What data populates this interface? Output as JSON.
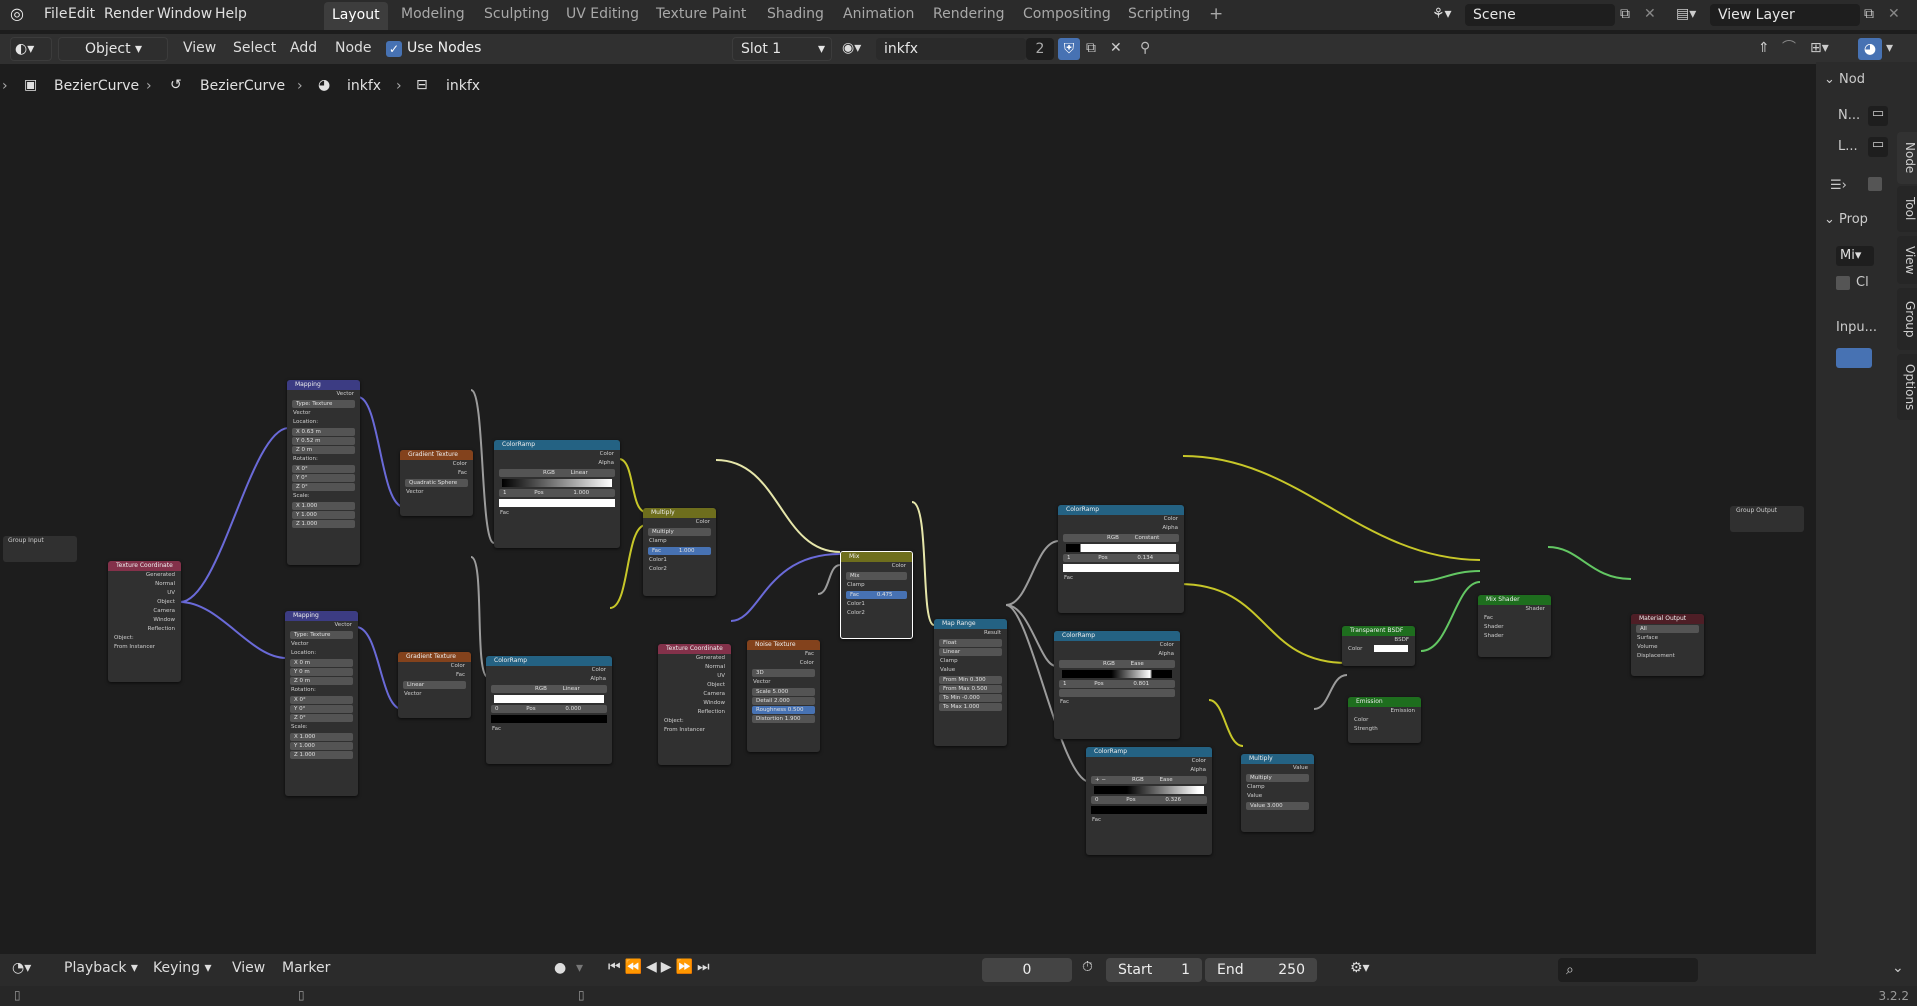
{
  "topbar": {
    "menus": [
      "File",
      "Edit",
      "Render",
      "Window",
      "Help"
    ],
    "workspaces": [
      "Layout",
      "Modeling",
      "Sculpting",
      "UV Editing",
      "Texture Paint",
      "Shading",
      "Animation",
      "Rendering",
      "Compositing",
      "Scripting"
    ],
    "active_workspace": "Layout",
    "add_tab": "+",
    "scene": "Scene",
    "view_layer": "View Layer"
  },
  "header": {
    "object_mode": "Object",
    "menus": [
      "View",
      "Select",
      "Add",
      "Node"
    ],
    "use_nodes": "Use Nodes",
    "slot": "Slot 1",
    "material": "inkfx",
    "users": "2"
  },
  "breadcrumb": [
    "BezierCurve",
    "BezierCurve",
    "inkfx",
    "inkfx"
  ],
  "npanel": {
    "node_title": "Nod",
    "name_label": "N...",
    "label_label": "L...",
    "props_title": "Prop",
    "mix_value": "Mi",
    "clamp_label": "Cl",
    "input_label": "Inpu...",
    "tabs": [
      "Node",
      "Tool",
      "View",
      "Group",
      "Options"
    ]
  },
  "timeline": {
    "playback": "Playback",
    "keying": "Keying",
    "view": "View",
    "marker": "Marker",
    "current_frame": "0",
    "start_label": "Start",
    "start": "1",
    "end_label": "End",
    "end": "250"
  },
  "status": {
    "version": "3.2.2"
  },
  "nodes": {
    "group_input": "Group Input",
    "texcoord1": {
      "title": "Texture Coordinate",
      "outputs": [
        "Generated",
        "Normal",
        "UV",
        "Object",
        "Camera",
        "Window",
        "Reflection"
      ],
      "object": "Object:",
      "from_instancer": "From Instancer"
    },
    "mapping1": {
      "title": "Mapping",
      "vector": "Vector",
      "type_label": "Type:",
      "type": "Texture",
      "vector_in": "Vector",
      "location": "Location:",
      "loc": [
        "X  0.63 m",
        "Y  0.52 m",
        "Z  0 m"
      ],
      "rotation": "Rotation:",
      "rot": [
        "X  0°",
        "Y  0°",
        "Z  0°"
      ],
      "scale": "Scale:",
      "scl": [
        "X  1.000",
        "Y  1.000",
        "Z  1.000"
      ]
    },
    "mapping2": {
      "title": "Mapping",
      "vector": "Vector",
      "type_label": "Type:",
      "type": "Texture",
      "vector_in": "Vector",
      "location": "Location:",
      "loc": [
        "X  0 m",
        "Y  0 m",
        "Z  0 m"
      ],
      "rotation": "Rotation:",
      "rot": [
        "X  0°",
        "Y  0°",
        "Z  0°"
      ],
      "scale": "Scale:",
      "scl": [
        "X  1.000",
        "Y  1.000",
        "Z  1.000"
      ]
    },
    "grad1": {
      "title": "Gradient Texture",
      "color": "Color",
      "fac": "Fac",
      "type": "Quadratic Sphere",
      "vector": "Vector"
    },
    "grad2": {
      "title": "Gradient Texture",
      "color": "Color",
      "fac": "Fac",
      "type": "Linear",
      "vector": "Vector"
    },
    "ramp1": {
      "title": "ColorRamp",
      "color": "Color",
      "alpha": "Alpha",
      "mode": "RGB",
      "interp": "Linear",
      "idx": "1",
      "pos_label": "Pos",
      "pos": "1.000",
      "fac": "Fac"
    },
    "ramp2": {
      "title": "ColorRamp",
      "color": "Color",
      "alpha": "Alpha",
      "mode": "RGB",
      "interp": "Linear",
      "idx": "0",
      "pos_label": "Pos",
      "pos": "0.000",
      "fac": "Fac"
    },
    "multiply1": {
      "title": "Multiply",
      "color": "Color",
      "op": "Multiply",
      "clamp": "Clamp",
      "fac_label": "Fac",
      "fac": "1.000",
      "color1": "Color1",
      "color2": "Color2"
    },
    "texcoord2": {
      "title": "Texture Coordinate",
      "outputs": [
        "Generated",
        "Normal",
        "UV",
        "Object",
        "Camera",
        "Window",
        "Reflection"
      ],
      "object": "Object:",
      "from_instancer": "From Instancer"
    },
    "noise": {
      "title": "Noise Texture",
      "fac": "Fac",
      "color": "Color",
      "dim": "3D",
      "vector": "Vector",
      "scale": "Scale 5.000",
      "detail": "Detail 2.000",
      "rough": "Roughness 0.500",
      "distortion": "Distortion 1.900"
    },
    "mix": {
      "title": "Mix",
      "color": "Color",
      "op": "Mix",
      "clamp": "Clamp",
      "fac_label": "Fac",
      "fac": "0.475",
      "color1": "Color1",
      "color2": "Color2"
    },
    "maprange": {
      "title": "Map Range",
      "result": "Result",
      "type": "Float",
      "interp": "Linear",
      "clamp": "Clamp",
      "value": "Value",
      "rows": [
        "From Min 0.300",
        "From Max 0.500",
        "To Min -0.000",
        "To Max 1.000"
      ]
    },
    "ramp3": {
      "title": "ColorRamp",
      "color": "Color",
      "alpha": "Alpha",
      "mode": "RGB",
      "interp": "Constant",
      "idx": "1",
      "pos_label": "Pos",
      "pos": "0.134",
      "fac": "Fac"
    },
    "ramp4": {
      "title": "ColorRamp",
      "color": "Color",
      "alpha": "Alpha",
      "mode": "RGB",
      "interp": "Ease",
      "idx": "1",
      "pos_label": "Pos",
      "pos": "0.801",
      "fac": "Fac"
    },
    "ramp5": {
      "title": "ColorRamp",
      "color": "Color",
      "alpha": "Alpha",
      "mode": "RGB",
      "interp": "Ease",
      "idx": "0",
      "pos_label": "Pos",
      "pos": "0.326",
      "fac": "Fac"
    },
    "multiply2": {
      "title": "Multiply",
      "value": "Value",
      "op": "Multiply",
      "clamp": "Clamp",
      "value_in": "Value",
      "value2": "Value 3.000"
    },
    "transparent": {
      "title": "Transparent BSDF",
      "bsdf": "BSDF",
      "color": "Color"
    },
    "emission": {
      "title": "Emission",
      "emission": "Emission",
      "color": "Color",
      "strength": "Strength"
    },
    "mixshader": {
      "title": "Mix Shader",
      "shader": "Shader",
      "fac": "Fac",
      "s1": "Shader",
      "s2": "Shader"
    },
    "output": {
      "title": "Material Output",
      "target": "All",
      "surface": "Surface",
      "volume": "Volume",
      "displacement": "Displacement"
    },
    "group_output": "Group Output"
  },
  "colors": {
    "header_vector": "#3c3c83",
    "header_texture": "#83421c",
    "header_converter": "#246283",
    "header_color": "#6e6e1d",
    "header_shader": "#1e6e1e",
    "header_output": "#4e1e26",
    "header_input": "#83314a",
    "socket_vector": "#6363c7",
    "socket_color": "#c7c729",
    "socket_float": "#a1a1a1",
    "socket_shader": "#63c763"
  }
}
